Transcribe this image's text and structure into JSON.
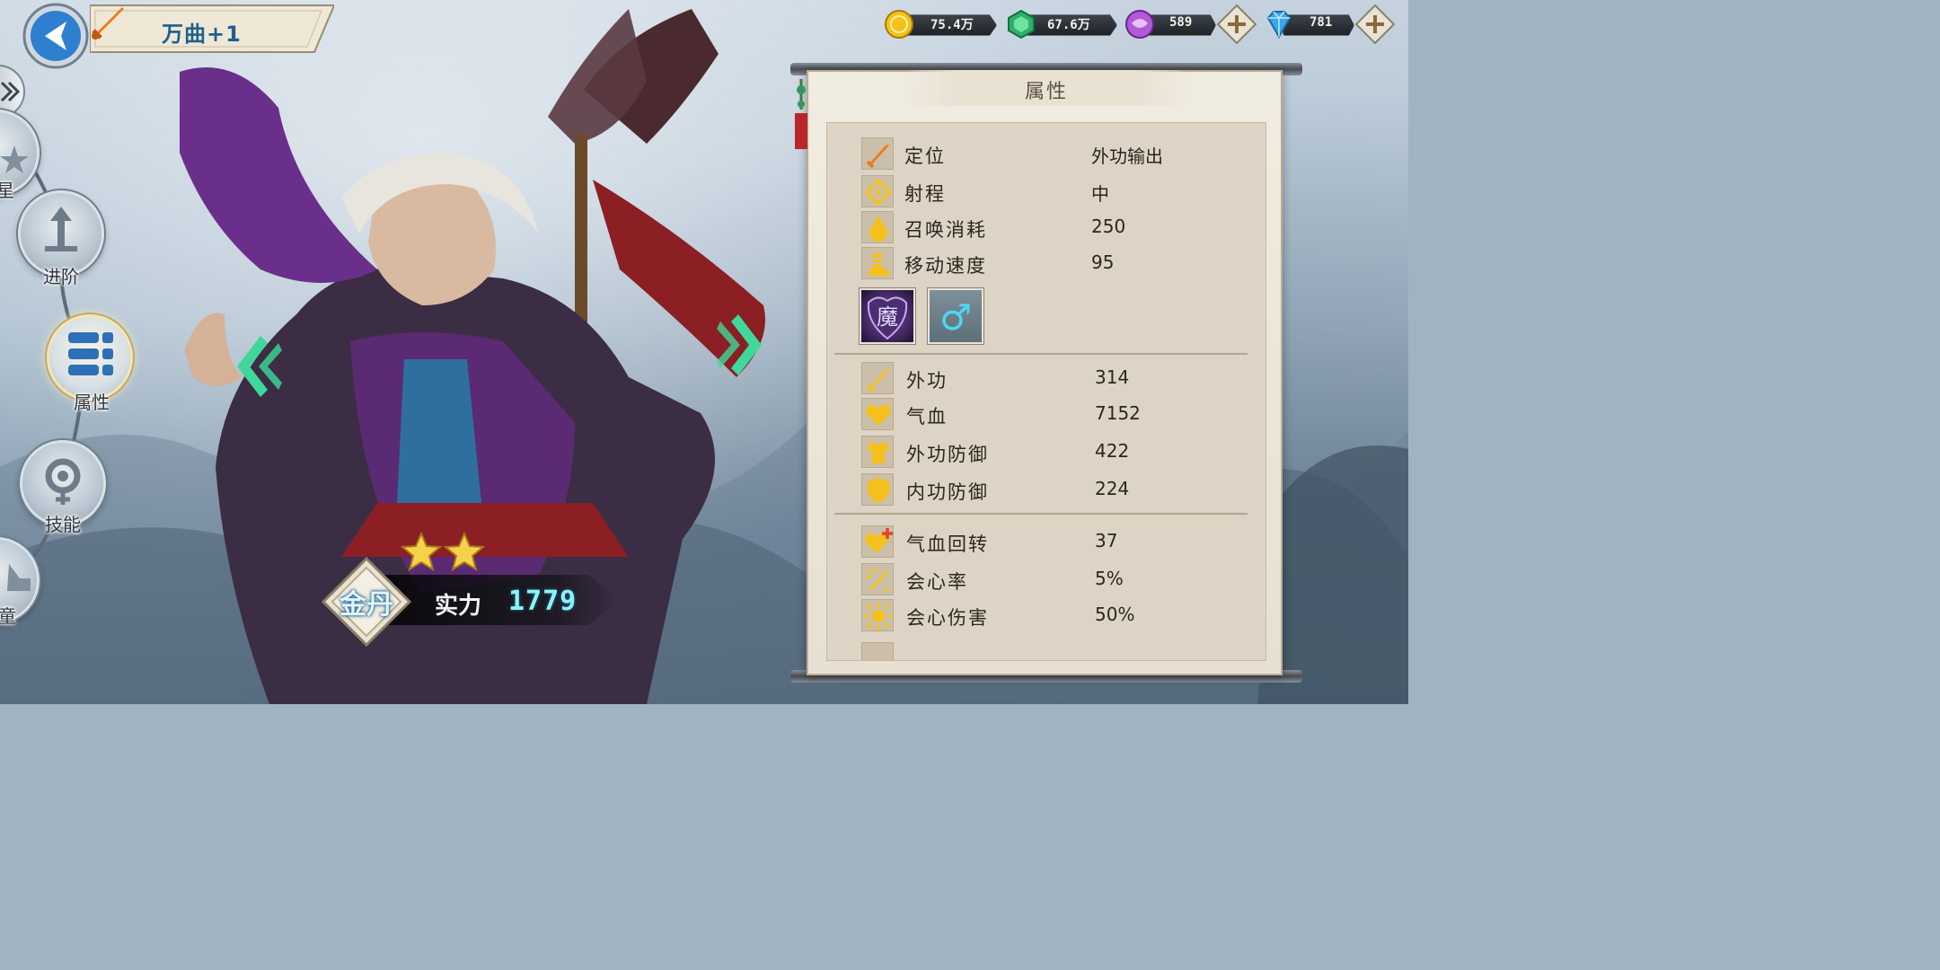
{
  "header": {
    "hero_name": "万曲+1"
  },
  "currencies": [
    {
      "name": "gold",
      "icon": "gold-coin-icon",
      "value": "75.4万",
      "color": "#f3c21a"
    },
    {
      "name": "jade",
      "icon": "green-jade-icon",
      "value": "67.6万",
      "color": "#2db06a"
    },
    {
      "name": "orb",
      "icon": "purple-orb-icon",
      "value": "589",
      "color": "#b05ad8",
      "has_plus": true
    },
    {
      "name": "diamond",
      "icon": "diamond-icon",
      "value": "781",
      "color": "#3aa8e8",
      "has_plus": true
    }
  ],
  "side_menu": {
    "items": [
      {
        "label": "星",
        "icon": "star-icon"
      },
      {
        "label": "进阶",
        "icon": "advance-arrow-icon"
      },
      {
        "label": "属性",
        "icon": "attribute-list-icon",
        "active": true
      },
      {
        "label": "技能",
        "icon": "skill-gear-icon"
      },
      {
        "label": "童",
        "icon": "companion-icon"
      }
    ]
  },
  "hero": {
    "stars": 2,
    "rank": "金丹",
    "power_label": "实力",
    "power_value": "1779"
  },
  "panel": {
    "title": "属性",
    "basic": [
      {
        "label": "定位",
        "value": "外功输出",
        "icon": "sword-icon"
      },
      {
        "label": "射程",
        "value": "中",
        "icon": "target-icon"
      },
      {
        "label": "召唤消耗",
        "value": "250",
        "icon": "drop-icon"
      },
      {
        "label": "移动速度",
        "value": "95",
        "icon": "boot-icon"
      }
    ],
    "tags": [
      {
        "name": "demon-faction",
        "icon": "demon-badge-icon",
        "glyph": "魔"
      },
      {
        "name": "male-gender",
        "icon": "male-gender-icon",
        "glyph": "♂"
      }
    ],
    "combat": [
      {
        "label": "外功",
        "value": "314",
        "icon": "sword-icon"
      },
      {
        "label": "气血",
        "value": "7152",
        "icon": "heart-icon"
      },
      {
        "label": "外功防御",
        "value": "422",
        "icon": "armor-icon"
      },
      {
        "label": "内功防御",
        "value": "224",
        "icon": "shield-icon"
      }
    ],
    "special": [
      {
        "label": "气血回转",
        "value": "37",
        "icon": "heart-plus-icon"
      },
      {
        "label": "会心率",
        "value": "5%",
        "icon": "crit-sword-icon"
      },
      {
        "label": "会心伤害",
        "value": "50%",
        "icon": "sun-burst-icon"
      }
    ]
  },
  "colors": {
    "accent_green": "#3fd89a",
    "panel_paper": "#e9e2d3",
    "icon_yellow": "#f4c11c",
    "power_cyan": "#8ff2f8"
  }
}
